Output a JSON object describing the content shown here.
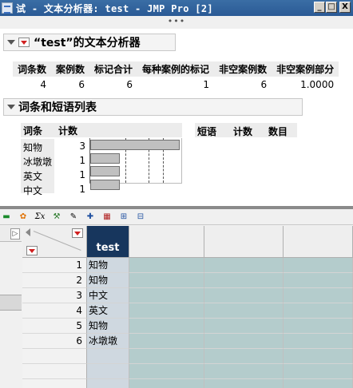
{
  "window": {
    "title": "试 - 文本分析器: test - JMP Pro [2]",
    "grip": "•••",
    "minimize": "_",
    "maximize": "□",
    "close": "X"
  },
  "report": {
    "title": "“test”的文本分析器",
    "summary": {
      "headers": [
        "词条数",
        "案例数",
        "标记合计",
        "每种案例的标记",
        "非空案例数",
        "非空案例部分"
      ],
      "values": [
        "4",
        "6",
        "6",
        "1",
        "6",
        "1.0000"
      ]
    },
    "terms_section": {
      "title": "词条和短语列表",
      "term_header": "词条",
      "count_header": "计数",
      "terms": [
        {
          "term": "知物",
          "count": 3
        },
        {
          "term": "冰墩墩",
          "count": 1
        },
        {
          "term": "英文",
          "count": 1
        },
        {
          "term": "中文",
          "count": 1
        }
      ],
      "phrase_headers": [
        "短语",
        "计数",
        "数目"
      ]
    }
  },
  "toolbar": {
    "icons": [
      "bars-icon",
      "color-icon",
      "formula-icon",
      "tools-icon",
      "edit-icon",
      "cross-icon",
      "grid-icon",
      "table-icon",
      "split-icon"
    ]
  },
  "data_table": {
    "column": "test",
    "rows": [
      "知物",
      "知物",
      "中文",
      "英文",
      "知物",
      "冰墩墩"
    ],
    "row_numbers": [
      "1",
      "2",
      "3",
      "4",
      "5",
      "6"
    ],
    "empty_rows": 3
  }
}
